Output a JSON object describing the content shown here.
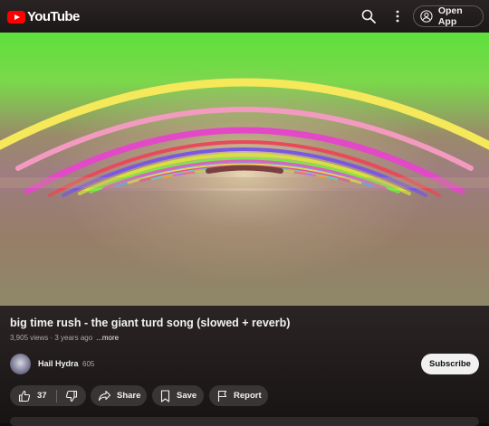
{
  "header": {
    "logo_text": "YouTube",
    "open_app_label": "Open App"
  },
  "video": {
    "title": "big time rush - the giant turd song (slowed + reverb)",
    "views": "3,905 views",
    "age": "3 years ago",
    "more_label": "...more"
  },
  "channel": {
    "name": "Hail Hydra",
    "subscribers": "605",
    "subscribe_label": "Subscribe"
  },
  "actions": {
    "like_count": "37",
    "share_label": "Share",
    "save_label": "Save",
    "report_label": "Report"
  },
  "icons": [
    "youtube-logo-icon",
    "search-icon",
    "more-vert-icon",
    "account-icon",
    "thumbs-up-icon",
    "thumbs-down-icon",
    "share-icon",
    "bookmark-icon",
    "flag-icon"
  ],
  "colors": {
    "brand": "#ff0000",
    "background": "#0f0f0f",
    "subscribe_bg": "#f1f1f1"
  }
}
